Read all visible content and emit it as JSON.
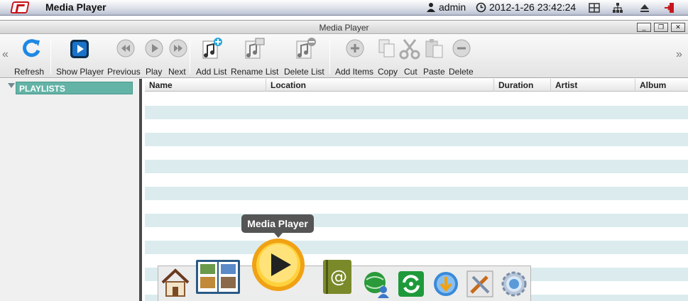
{
  "sysbar": {
    "app_name": "Media Player",
    "user": "admin",
    "datetime": "2012-1-26 23:42:24",
    "icons": [
      "app-logo-icon",
      "user-icon",
      "clock-icon",
      "grid-icon",
      "network-icon",
      "eject-icon",
      "logout-icon"
    ]
  },
  "window": {
    "title": "Media Player",
    "controls": {
      "minimize": "_",
      "restore": "❐",
      "close": "✕"
    }
  },
  "toolbar": {
    "refresh": "Refresh",
    "show_player": "Show Player",
    "previous": "Previous",
    "play": "Play",
    "next": "Next",
    "add_list": "Add List",
    "rename_list": "Rename List",
    "delete_list": "Delete List",
    "add_items": "Add Items",
    "copy": "Copy",
    "cut": "Cut",
    "paste": "Paste",
    "delete": "Delete",
    "scroll_left": "«",
    "scroll_right": "»"
  },
  "sidebar": {
    "playlists": "PLAYLISTS"
  },
  "table": {
    "columns": [
      "Name",
      "Location",
      "Duration",
      "Artist",
      "Album"
    ]
  },
  "dock": {
    "tooltip": "Media Player",
    "items": [
      "home-icon",
      "photo-album-icon",
      "media-player-icon",
      "address-book-icon",
      "network-user-icon",
      "sync-icon",
      "download-icon",
      "settings-tools-icon",
      "gear-icon"
    ]
  },
  "colors": {
    "accent_teal": "#63b3a6",
    "stripe": "#dcecee",
    "toolbar_blue": "#1a73c9"
  }
}
